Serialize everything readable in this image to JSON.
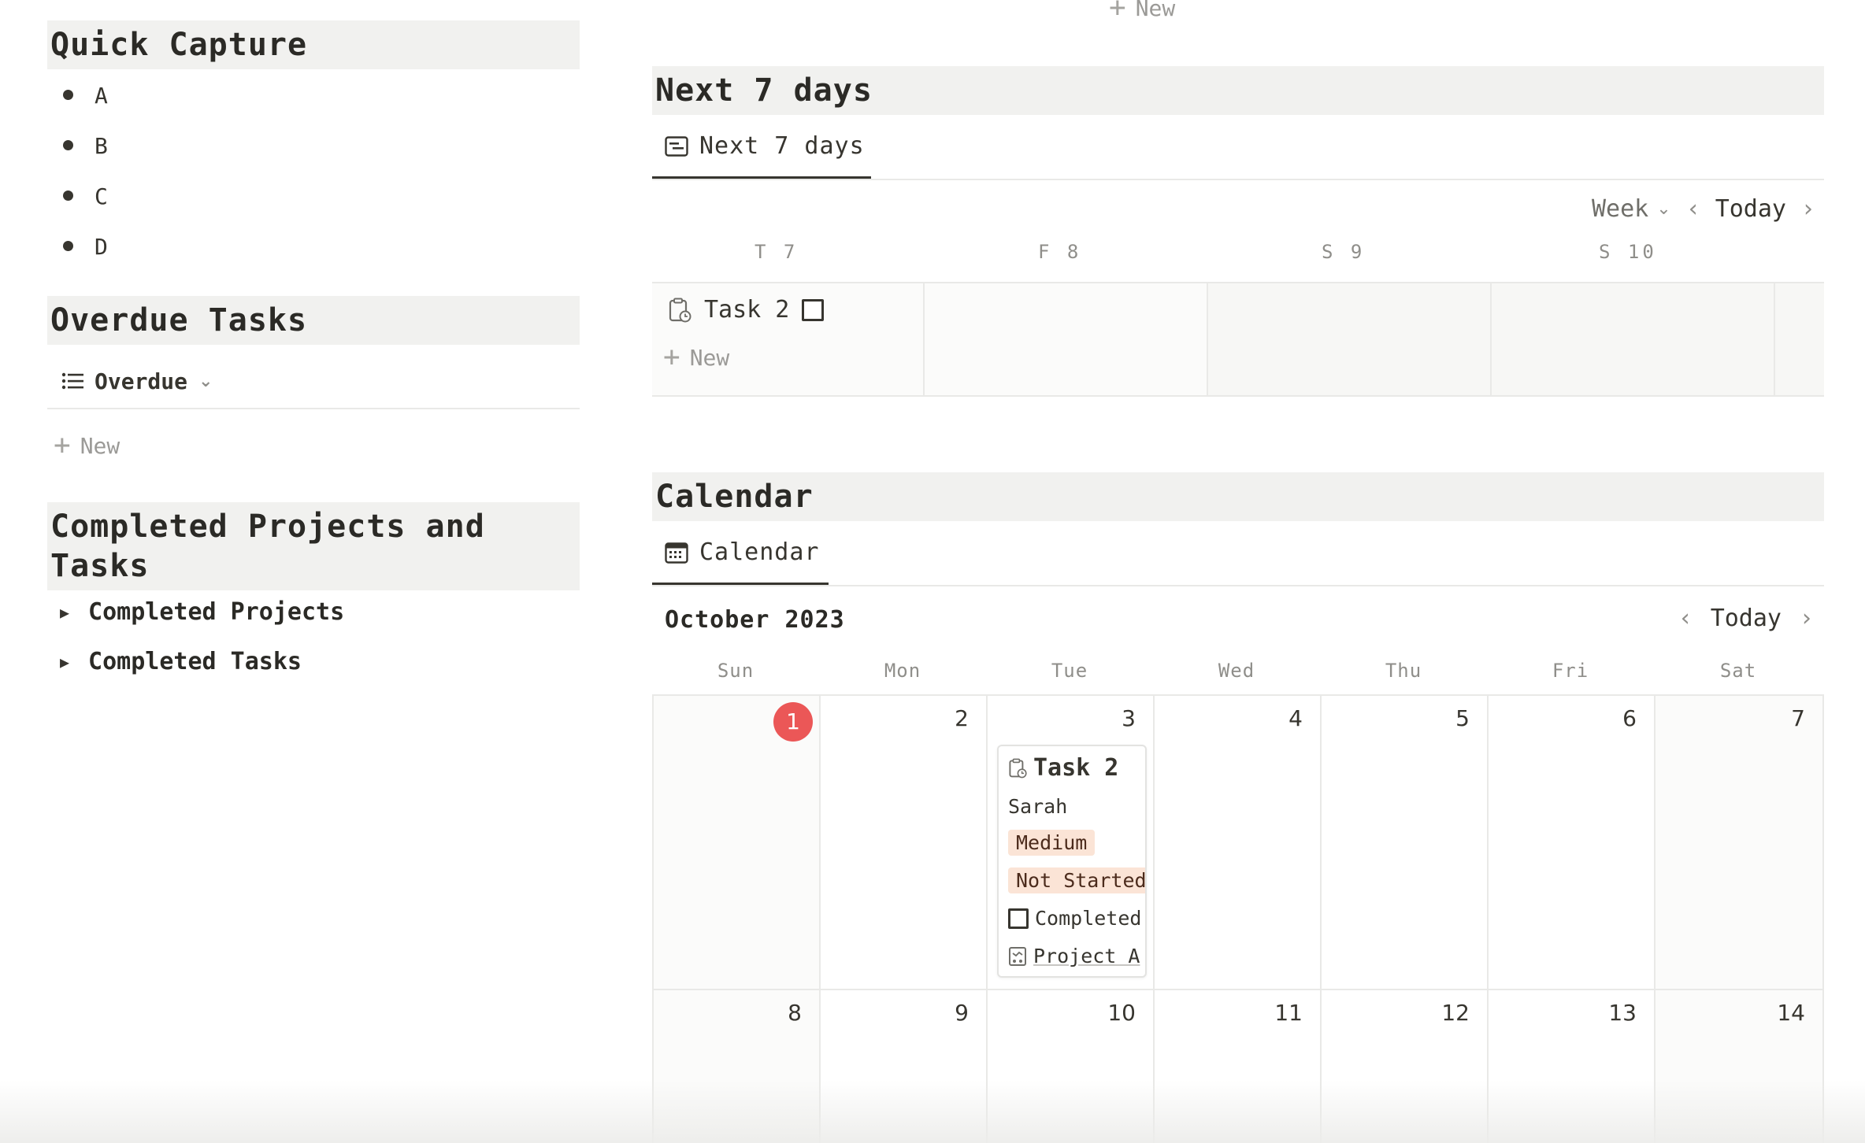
{
  "top_new": {
    "label": "New"
  },
  "quick_capture": {
    "title": "Quick Capture",
    "items": [
      "A",
      "B",
      "C",
      "D"
    ]
  },
  "overdue": {
    "title": "Overdue Tasks",
    "view_label": "Overdue",
    "new_label": "New"
  },
  "completed": {
    "title": "Completed Projects and Tasks",
    "toggles": [
      "Completed Projects",
      "Completed Tasks"
    ]
  },
  "next7": {
    "title": "Next 7 days",
    "tab_label": "Next 7 days",
    "range_label": "Week",
    "today_label": "Today",
    "days": [
      "T  7",
      "F  8",
      "S  9",
      "S  10"
    ],
    "task_name": "Task 2",
    "new_label": "New"
  },
  "calendar": {
    "title": "Calendar",
    "tab_label": "Calendar",
    "month_label": "October 2023",
    "today_label": "Today",
    "weekdays": [
      "Sun",
      "Mon",
      "Tue",
      "Wed",
      "Thu",
      "Fri",
      "Sat"
    ],
    "week1": [
      "1",
      "2",
      "3",
      "4",
      "5",
      "6",
      "7"
    ],
    "week2": [
      "8",
      "9",
      "10",
      "11",
      "12",
      "13",
      "14"
    ],
    "event": {
      "title": "Task 2",
      "assignee": "Sarah",
      "priority": "Medium",
      "status": "Not Started",
      "checkbox_label": "Completed",
      "project": "Project A"
    }
  },
  "colors": {
    "heading_bg": "#f1f1ef",
    "today_badge": "#eb5757",
    "pill_bg": "#fbe4d6"
  }
}
